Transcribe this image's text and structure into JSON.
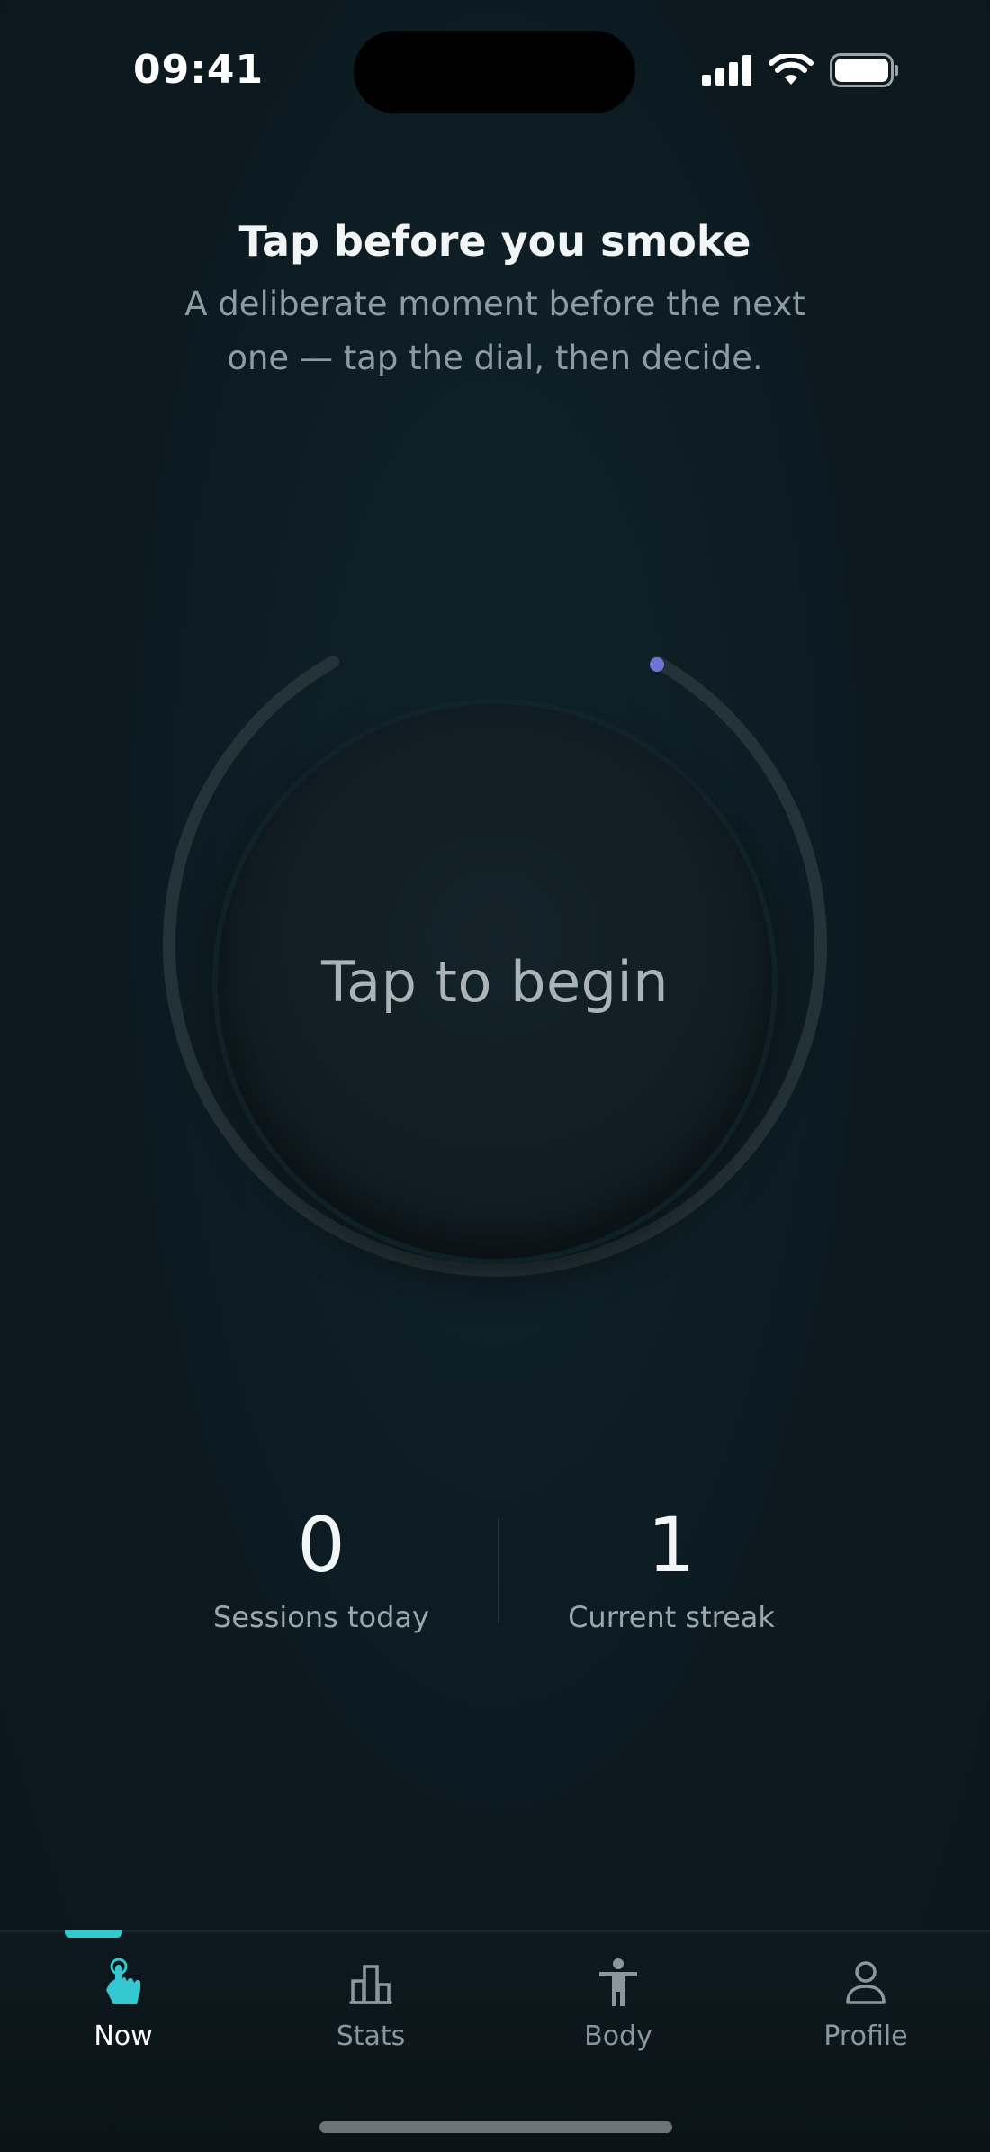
{
  "status_bar": {
    "time": "09:41",
    "icons": [
      "cellular-signal-icon",
      "wifi-icon",
      "battery-icon"
    ]
  },
  "header": {
    "title": "Tap before you smoke",
    "subtitle": "A deliberate moment before the next one — tap the dial, then decide."
  },
  "dial": {
    "label": "Tap to begin",
    "accent_color": "#6f74d6",
    "track_color": "#243338"
  },
  "stats": {
    "sessions_today": {
      "value": "0",
      "label": "Sessions today"
    },
    "current_streak": {
      "value": "1",
      "label": "Current streak"
    }
  },
  "tabs": [
    {
      "label": "Now",
      "icon": "tap-hand-icon",
      "active": true
    },
    {
      "label": "Stats",
      "icon": "bar-chart-icon",
      "active": false
    },
    {
      "label": "Body",
      "icon": "body-figure-icon",
      "active": false
    },
    {
      "label": "Profile",
      "icon": "user-icon",
      "active": false
    }
  ],
  "colors": {
    "accent": "#35c7cf",
    "background": "#0c1a1f"
  }
}
